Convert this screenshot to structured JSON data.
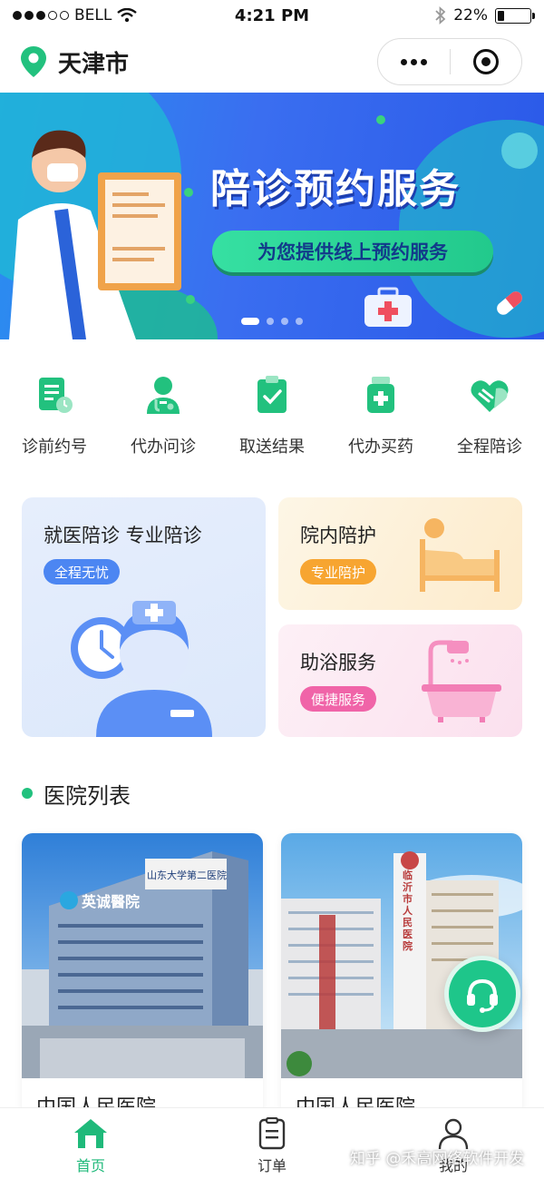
{
  "status_bar": {
    "carrier": "BELL",
    "time": "4:21 PM",
    "battery": "22%",
    "battery_level": 0.22
  },
  "header": {
    "city": "天津市"
  },
  "banner": {
    "title": "陪诊预约服务",
    "subtitle": "为您提供线上预约服务",
    "slide_count": 4,
    "active_slide": 0
  },
  "quick_menu": [
    {
      "label": "诊前约号",
      "icon": "appointment-form-icon"
    },
    {
      "label": "代办问诊",
      "icon": "doctor-icon"
    },
    {
      "label": "取送结果",
      "icon": "clipboard-check-icon"
    },
    {
      "label": "代办买药",
      "icon": "medicine-bottle-icon"
    },
    {
      "label": "全程陪诊",
      "icon": "heart-hand-icon"
    }
  ],
  "feature_cards": {
    "main": {
      "title": "就医陪诊 专业陪诊",
      "badge": "全程无忧"
    },
    "care": {
      "title": "院内陪护",
      "badge": "专业陪护"
    },
    "bath": {
      "title": "助浴服务",
      "badge": "便捷服务"
    }
  },
  "section": {
    "title": "医院列表"
  },
  "hospitals": [
    {
      "name": "中国人民医院",
      "sign_text": "山东大学第二医院",
      "logo_text": "英诚醫院"
    },
    {
      "name": "中国人民医院",
      "sign_text": "临沂市人民医院"
    }
  ],
  "tab_bar": [
    {
      "label": "首页",
      "active": true
    },
    {
      "label": "订单",
      "active": false
    },
    {
      "label": "我的",
      "active": false
    }
  ],
  "watermark": "知乎 @禾高网络软件开发",
  "colors": {
    "accent": "#1fb97a",
    "banner": "#3a6ef0",
    "badge_blue": "#4c86f2",
    "badge_orange": "#f7a531",
    "badge_pink": "#f064a8"
  }
}
